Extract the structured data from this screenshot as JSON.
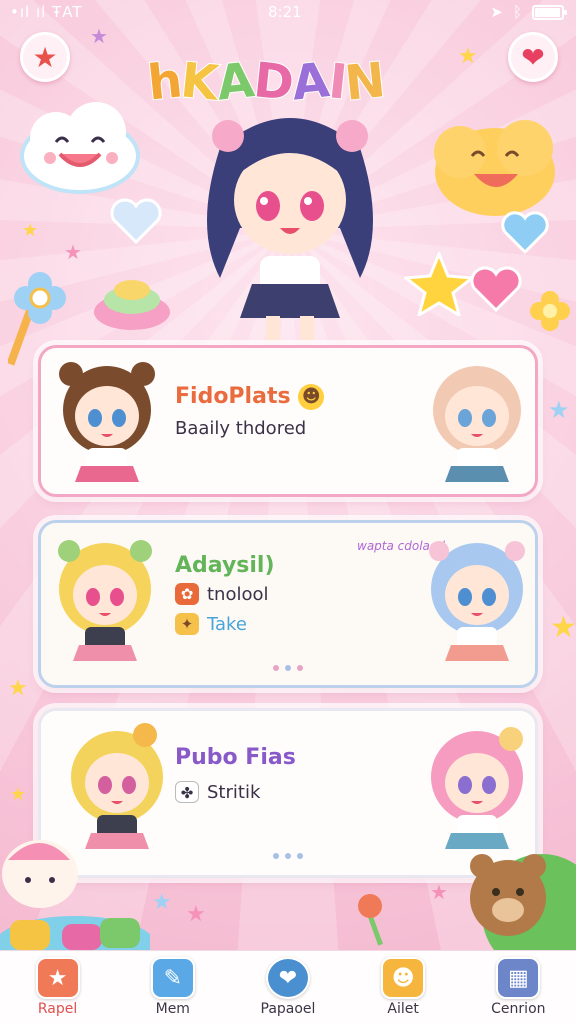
{
  "status_bar": {
    "left": "•ıl ıl ŦAT",
    "time": "8:21",
    "battery_level": 0.9
  },
  "header": {
    "left_button_icon": "star-icon",
    "right_button_icon": "heart-bubble-icon",
    "logo_letters": [
      "h",
      "K",
      "A",
      "D",
      "A",
      "I",
      "N"
    ],
    "logo_colors": [
      "#f4a634",
      "#f6c443",
      "#7bc96a",
      "#e76aa7",
      "#9a6fd8",
      "#f08bb6",
      "#f3b64a"
    ]
  },
  "cards": [
    {
      "title": "FidoPlats",
      "title_color": "#ea6b3e",
      "title_emoji": "☻",
      "lines": [
        {
          "icon": "",
          "text": "Baaily thdored"
        }
      ],
      "tag": "",
      "border_color": "#f3a7c5"
    },
    {
      "title": "Adaysil)",
      "title_color": "#64b55a",
      "tag": "wapta cdolaod",
      "lines": [
        {
          "icon": "ghost-icon",
          "text": "tnolool"
        },
        {
          "icon": "sparkle-icon",
          "text": "Take"
        }
      ],
      "dot_colors": [
        "#e9a4c4",
        "#a8bfe8",
        "#e9a4c4"
      ],
      "border_color": "#bcd2ec"
    },
    {
      "title": "Pubo Fias",
      "title_color": "#8a59c9",
      "tag": "",
      "lines": [
        {
          "icon": "bear-paw-icon",
          "text": "Stritik"
        }
      ],
      "dot_colors": [
        "#a8bfe8",
        "#a8bfe8",
        "#a8bfe8"
      ],
      "border_color": "#e9e7ef"
    }
  ],
  "bottom_nav": {
    "active_index": 0,
    "items": [
      {
        "label": "Rapel",
        "icon": "home-star-icon",
        "color": "#f07a58"
      },
      {
        "label": "Mem",
        "icon": "chat-bubble-icon",
        "color": "#5aa9e6"
      },
      {
        "label": "Papaoel",
        "icon": "compass-heart-icon",
        "color": "#4a8fcf"
      },
      {
        "label": "Ailet",
        "icon": "fireball-icon",
        "color": "#f6b63d"
      },
      {
        "label": "Cenrion",
        "icon": "calendar-icon",
        "color": "#6d86c9"
      }
    ]
  }
}
